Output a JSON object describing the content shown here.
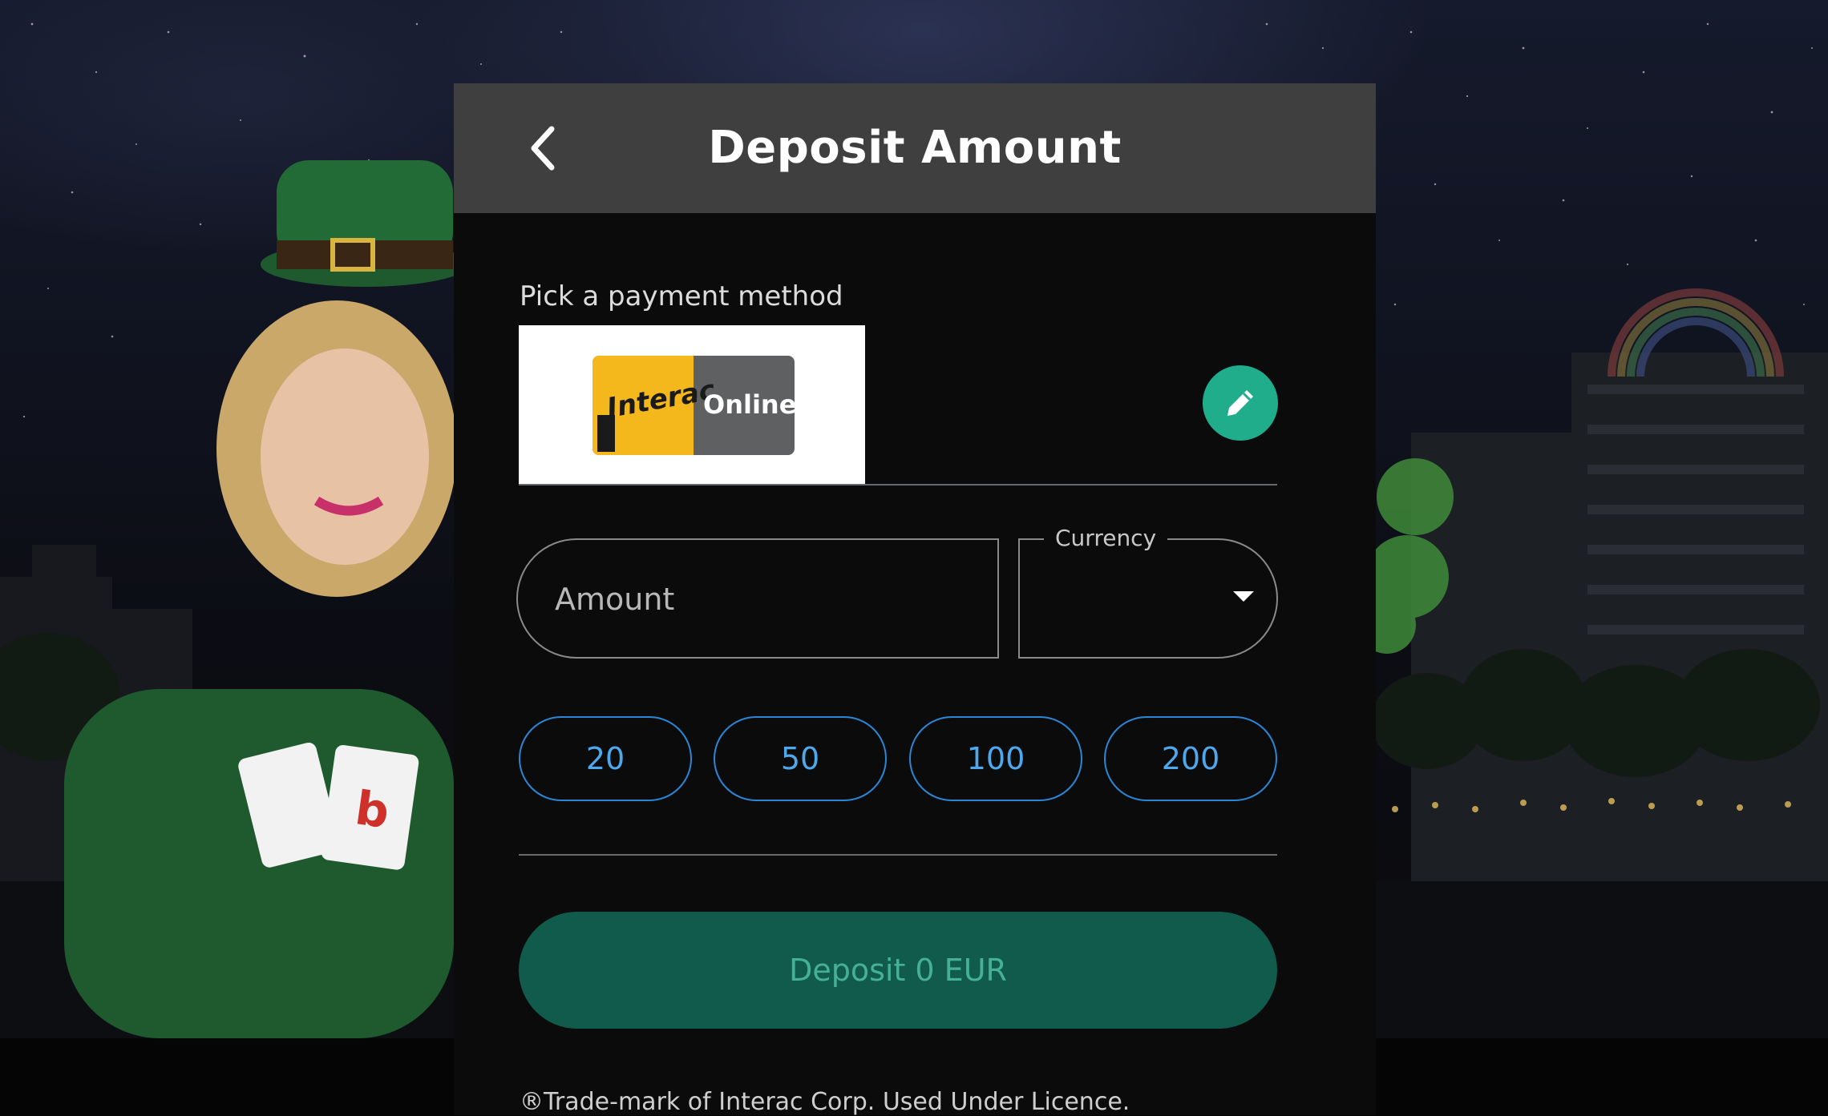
{
  "header": {
    "title": "Deposit Amount",
    "back_icon": "chevron-left-icon"
  },
  "payment": {
    "label": "Pick a payment method",
    "method": {
      "logo_left_text": "Interac",
      "logo_right_text": "Online"
    },
    "edit_icon": "pencil-icon"
  },
  "amount": {
    "placeholder": "Amount",
    "value": ""
  },
  "currency": {
    "label": "Currency",
    "value": "",
    "caret_icon": "caret-down-icon"
  },
  "quick_amounts": [
    "20",
    "50",
    "100",
    "200"
  ],
  "deposit_button": {
    "label": "Deposit 0 EUR"
  },
  "footer": {
    "trademark": "®Trade-mark of Interac Corp. Used Under Licence."
  },
  "colors": {
    "accent_teal": "#20ad8c",
    "deposit_bg": "#115b4d",
    "quick_blue": "#2a86d6",
    "header_bg": "#3f3f40",
    "modal_bg": "#0b0b0c"
  }
}
